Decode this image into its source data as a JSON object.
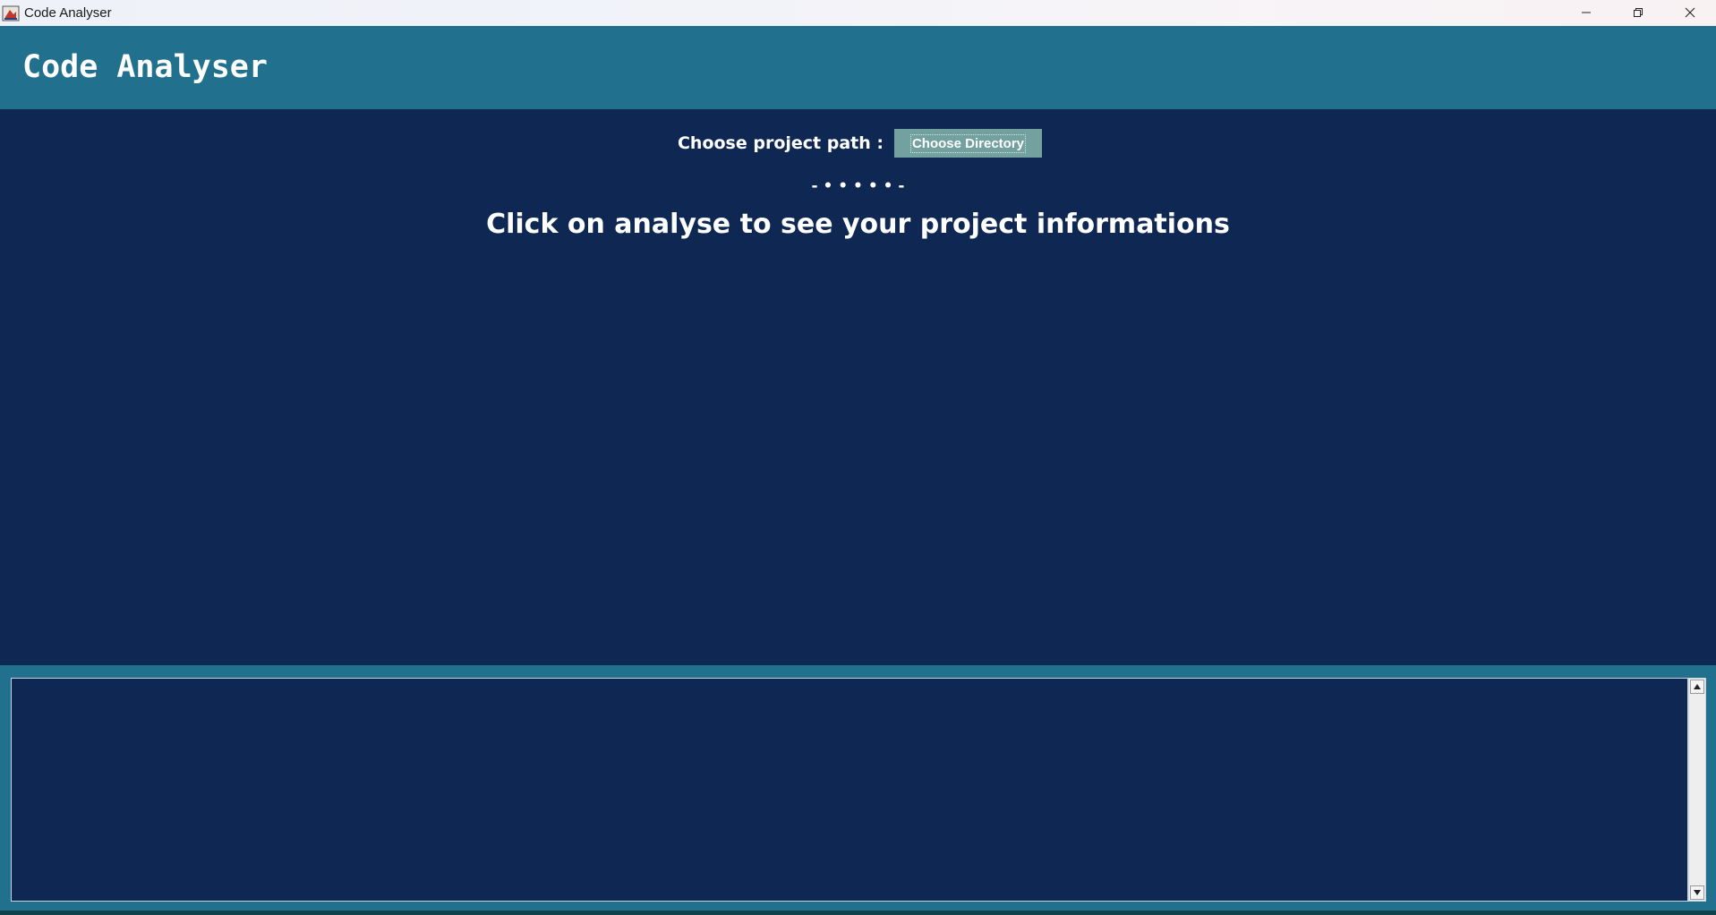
{
  "window": {
    "title": "Code Analyser",
    "controls": [
      "minimize-icon",
      "restore-icon",
      "close-icon"
    ]
  },
  "header": {
    "title": "Code Analyser"
  },
  "main": {
    "path_label": "Choose project path :",
    "choose_button": "Choose Directory",
    "separator": "- • • • • • -",
    "message": "Click on analyse to see your project informations"
  },
  "output": {
    "content": ""
  },
  "colors": {
    "header_band": "#20708e",
    "background": "#0f2853",
    "button": "#73a19f",
    "text": "#ffffff"
  }
}
